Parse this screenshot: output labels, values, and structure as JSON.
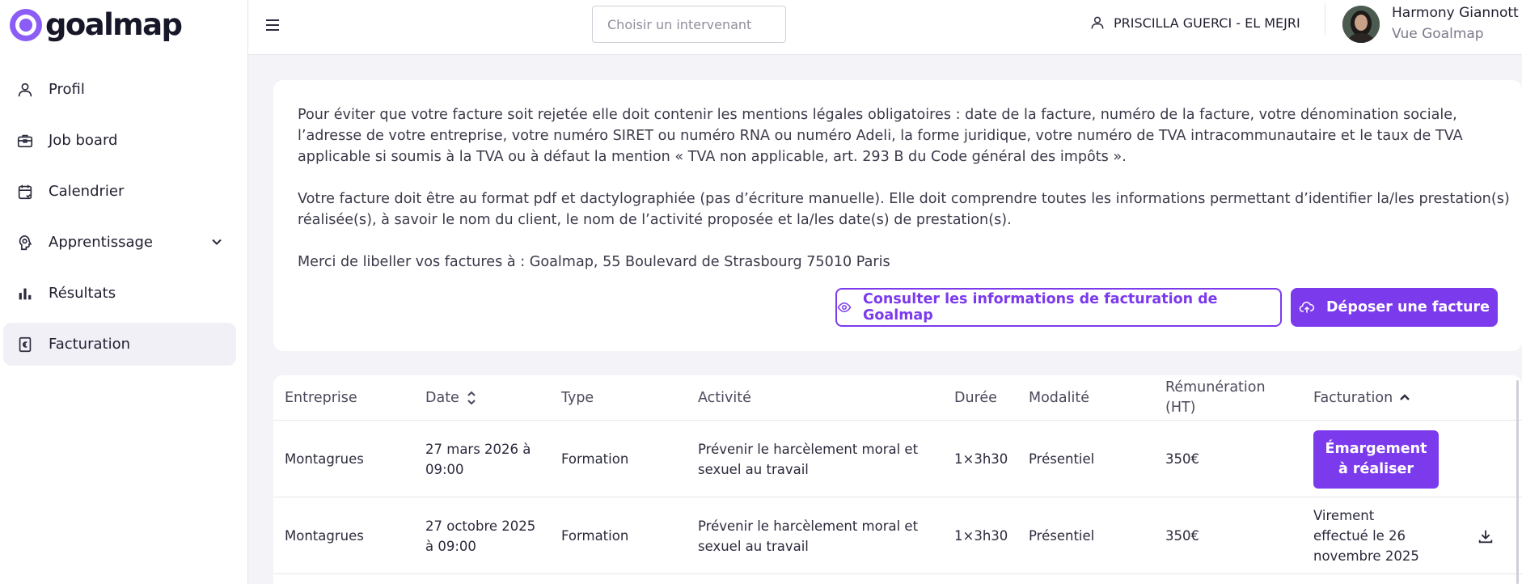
{
  "brand": {
    "name": "goalmap",
    "accent": "#7c3aed"
  },
  "sidebar": {
    "items": [
      {
        "label": "Profil",
        "icon": "user-icon"
      },
      {
        "label": "Job board",
        "icon": "briefcase-icon"
      },
      {
        "label": "Calendrier",
        "icon": "calendar-icon"
      },
      {
        "label": "Apprentissage",
        "icon": "brain-icon",
        "expandable": true
      },
      {
        "label": "Résultats",
        "icon": "bar-chart-icon"
      },
      {
        "label": "Facturation",
        "icon": "invoice-icon",
        "active": true
      }
    ]
  },
  "header": {
    "search_placeholder": "Choisir un intervenant",
    "intervenant": "PRISCILLA GUERCI - EL MEJRI",
    "user_name": "Harmony Giannott",
    "user_view": "Vue Goalmap"
  },
  "info": {
    "paragraph1": "Pour éviter que votre facture soit rejetée elle doit contenir les mentions légales obligatoires : date de la facture, numéro de la facture, votre dénomination sociale, l’adresse de votre entreprise, votre numéro SIRET ou numéro RNA ou numéro Adeli, la forme juridique, votre numéro de TVA intracommunautaire et le taux de TVA applicable si soumis à la TVA ou à défaut la mention « TVA non applicable, art. 293 B du Code général des impôts ».",
    "paragraph2": "Votre facture doit être au format pdf et dactylographiée (pas d’écriture manuelle). Elle doit comprendre toutes les informations permettant d’identifier la/les prestation(s) réalisée(s), à savoir le nom du client, le nom de l’activité proposée et la/les date(s) de prestation(s).",
    "paragraph3": "Merci de libeller vos factures à : Goalmap, 55 Boulevard de Strasbourg 75010 Paris",
    "consult_label": "Consulter les informations de facturation de Goalmap",
    "upload_label": "Déposer une facture"
  },
  "table": {
    "columns": {
      "entreprise": "Entreprise",
      "date": "Date",
      "type": "Type",
      "activite": "Activité",
      "duree": "Durée",
      "modalite": "Modalité",
      "remuneration": "Rémunération (HT)",
      "facturation": "Facturation"
    },
    "rows": [
      {
        "entreprise": "Montagrues",
        "date": "27 mars 2026 à 09:00",
        "type": "Formation",
        "activite": "Prévenir le harcèlement moral et sexuel au travail",
        "duree": "1×3h30",
        "modalite": "Présentiel",
        "remuneration": "350€",
        "facturation": "Émargement à réaliser"
      },
      {
        "entreprise": "Montagrues",
        "date": "27 octobre 2025 à 09:00",
        "type": "Formation",
        "activite": "Prévenir le harcèlement moral et sexuel au travail",
        "duree": "1×3h30",
        "modalite": "Présentiel",
        "remuneration": "350€",
        "facturation": "Virement effectué le 26 novembre 2025"
      }
    ]
  }
}
